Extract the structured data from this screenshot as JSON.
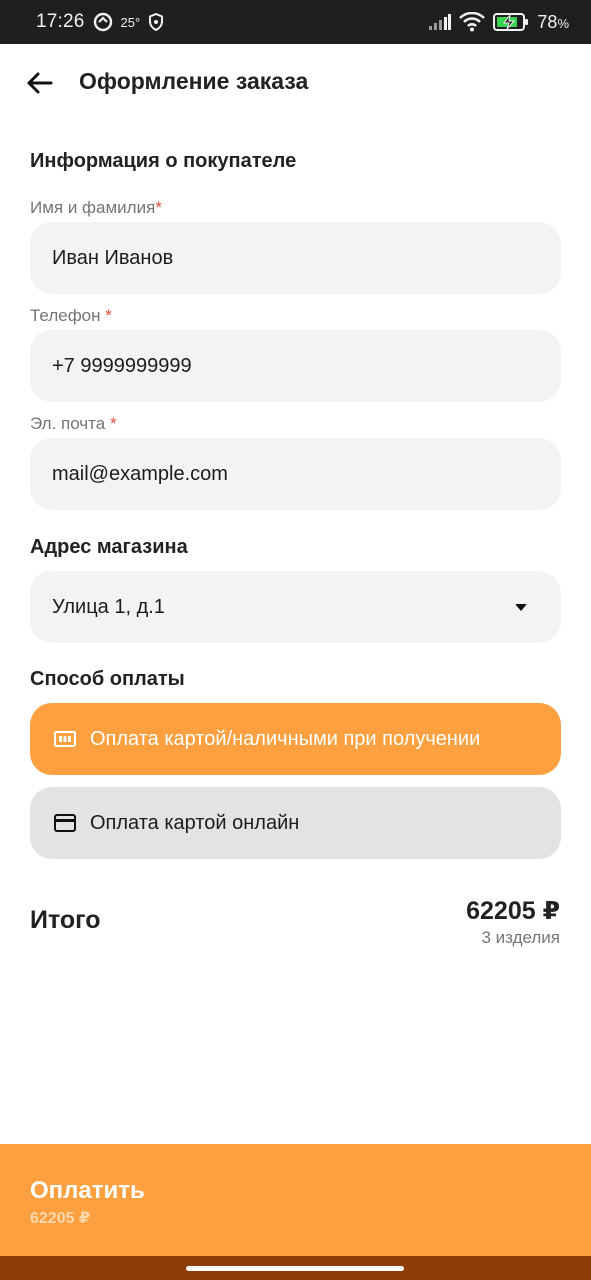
{
  "status_bar": {
    "time": "17:26",
    "temperature": "25°",
    "battery_percent": "78",
    "battery_suffix": "%"
  },
  "header": {
    "title": "Оформление заказа"
  },
  "buyer_section": {
    "title": "Информация о покупателе",
    "name_label": "Имя и фамилия",
    "name_value": "Иван Иванов",
    "phone_label": "Телефон ",
    "phone_value": "+7 9999999999",
    "email_label": "Эл. почта ",
    "email_value": "mail@example.com",
    "required_mark": "*"
  },
  "store_section": {
    "title": "Адрес магазина",
    "selected_store": "Улица 1, д.1"
  },
  "payment_section": {
    "title": "Способ оплаты",
    "options": [
      {
        "label": "Оплата картой/наличными при получении",
        "icon": "cash-icon",
        "selected": true
      },
      {
        "label": "Оплата картой онлайн",
        "icon": "credit-card-icon",
        "selected": false
      }
    ]
  },
  "total": {
    "label": "Итого",
    "amount": "62205 ₽",
    "items_count": "3 изделия"
  },
  "pay_button": {
    "label": "Оплатить",
    "amount": "62205 ₽"
  },
  "colors": {
    "accent": "#ffa040",
    "field_bg": "#f3f3f3",
    "unselected_bg": "#e3e3e3",
    "required": "#e24c3a",
    "nav_bar": "#8c3e06"
  }
}
